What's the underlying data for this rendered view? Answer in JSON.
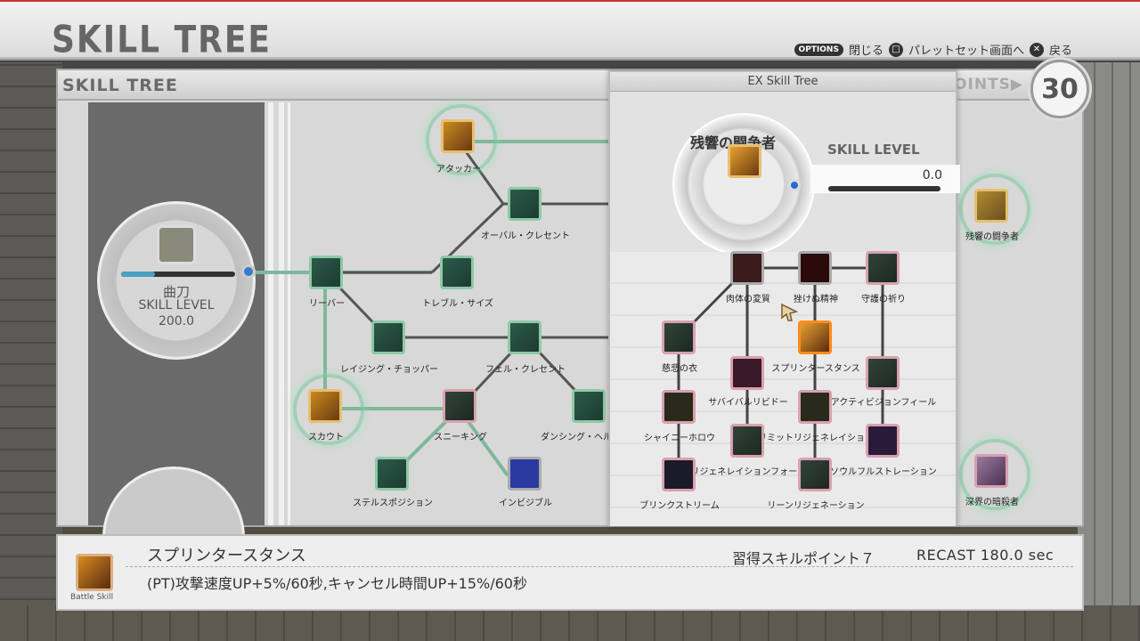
{
  "header": {
    "title": "SKILL TREE",
    "hints": {
      "options_badge": "OPTIONS",
      "close_label": "閉じる",
      "square_symbol": "□",
      "palette_label": "パレットセット画面へ",
      "cross_symbol": "✕",
      "back_label": "戻る"
    }
  },
  "panel": {
    "title": "SKILL TREE",
    "points_label": "POINTS▶",
    "points_value": "30"
  },
  "weapon_dial": {
    "name": "曲刀",
    "level_label": "SKILL LEVEL",
    "level_value": "200.0",
    "progress": 0.3
  },
  "tree_nodes": [
    {
      "label": "アタッカー"
    },
    {
      "label": "オーバル・クレセント"
    },
    {
      "label": "リーバー"
    },
    {
      "label": "トレブル・サイズ"
    },
    {
      "label": "レイジング・チョッパー"
    },
    {
      "label": "フェル・クレセント"
    },
    {
      "label": "スカウト"
    },
    {
      "label": "スニーキング"
    },
    {
      "label": "ダンシング・ヘル"
    },
    {
      "label": "ステルスポジション"
    },
    {
      "label": "インビジブル"
    },
    {
      "label": "残響の闘争者"
    },
    {
      "label": "深界の暗殺者"
    }
  ],
  "ex_tree": {
    "title": "EX Skill Tree",
    "name": "残響の闘争者",
    "level_label": "SKILL LEVEL",
    "level_value": "0.0",
    "nodes": [
      {
        "label": "肉体の変質"
      },
      {
        "label": "挫けぬ精神"
      },
      {
        "label": "守護の祈り"
      },
      {
        "label": "慈悲の衣"
      },
      {
        "label": "スプリンタースタンス"
      },
      {
        "label": "サバイバルリビドー"
      },
      {
        "label": "アクティビジョンフィール"
      },
      {
        "label": "シャイニーホロウ"
      },
      {
        "label": "リミットリジェネレイション"
      },
      {
        "label": "リジェネレイションフォース"
      },
      {
        "label": "ソウルフルストレーション"
      },
      {
        "label": "ブリンクストリーム"
      },
      {
        "label": "リーンリジェネーション"
      }
    ]
  },
  "info": {
    "icon_label": "Battle Skill",
    "skill_name": "スプリンタースタンス",
    "cost": "習得スキルポイント７",
    "recast": "RECAST 180.0 sec",
    "description": "(PT)攻撃速度UP+5%/60秒,キャンセル時間UP+15%/60秒"
  }
}
